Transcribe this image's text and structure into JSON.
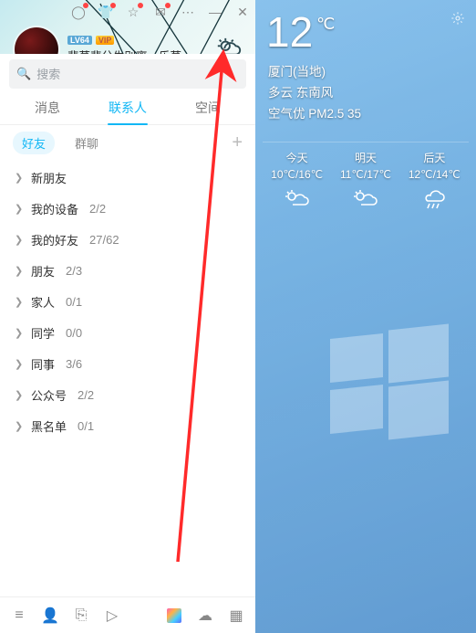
{
  "titlebar": {
    "icons": [
      "medal-icon",
      "tshirt-icon",
      "star-icon",
      "mail-icon",
      "more-icon",
      "minimize-icon",
      "close-icon"
    ]
  },
  "profile": {
    "level_badge": "LV64",
    "vip_badge": "VIP",
    "nickname": "悲莫悲兮生别离，乐莫..."
  },
  "search": {
    "placeholder": "搜索"
  },
  "tabs": {
    "items": [
      "消息",
      "联系人",
      "空间"
    ],
    "active_index": 1
  },
  "subtabs": {
    "items": [
      "好友",
      "群聊"
    ],
    "active_index": 0,
    "add_label": "+"
  },
  "groups": [
    {
      "name": "新朋友",
      "count": ""
    },
    {
      "name": "我的设备",
      "count": "2/2"
    },
    {
      "name": "我的好友",
      "count": "27/62"
    },
    {
      "name": "朋友",
      "count": "2/3"
    },
    {
      "name": "家人",
      "count": "0/1"
    },
    {
      "name": "同学",
      "count": "0/0"
    },
    {
      "name": "同事",
      "count": "3/6"
    },
    {
      "name": "公众号",
      "count": "2/2"
    },
    {
      "name": "黑名单",
      "count": "0/1"
    }
  ],
  "bottombar": {
    "icons": [
      "menu-icon",
      "add-contact-icon",
      "link-icon",
      "play-icon",
      "news-icon",
      "cloud-icon",
      "apps-icon"
    ]
  },
  "weather": {
    "temp": "12",
    "unit": "℃",
    "location": "厦门(当地)",
    "condition": "多云 东南风",
    "air": "空气优 PM2.5 35",
    "forecast": [
      {
        "label": "今天",
        "range": "10℃/16℃",
        "icon": "partly-cloudy"
      },
      {
        "label": "明天",
        "range": "11℃/17℃",
        "icon": "partly-cloudy"
      },
      {
        "label": "后天",
        "range": "12℃/14℃",
        "icon": "rain"
      }
    ]
  },
  "annotation": {
    "kind": "arrow",
    "color": "#ff2a2a"
  }
}
